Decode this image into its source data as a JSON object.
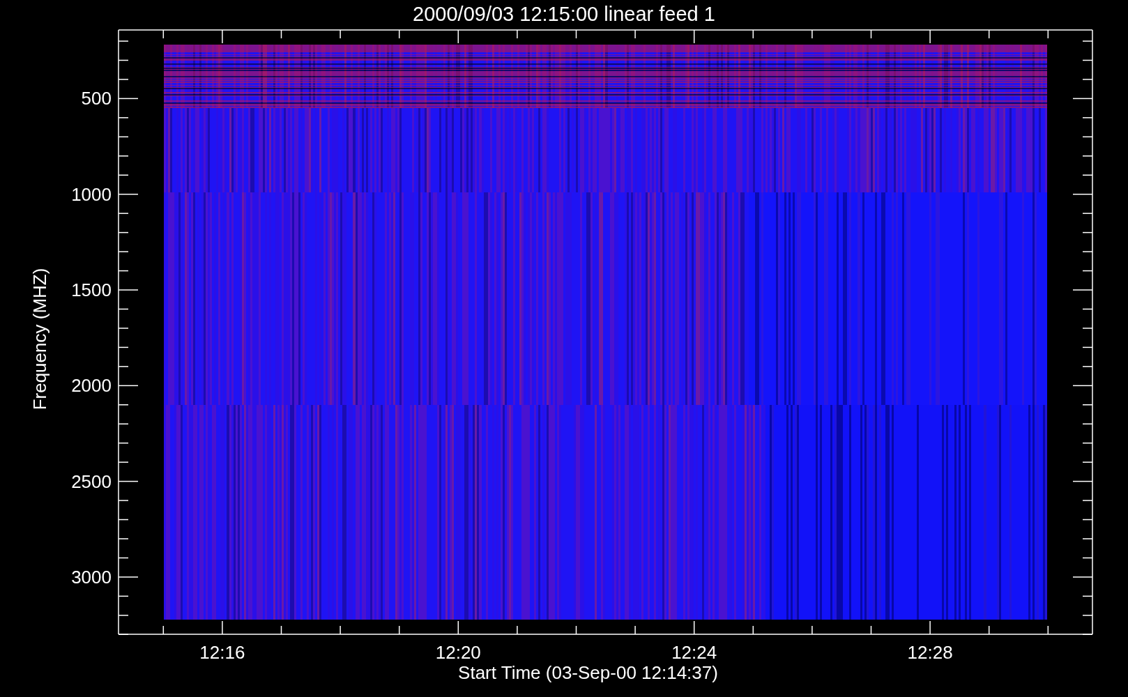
{
  "plot": {
    "title": "2000/09/03 12:15:00 linear feed 1",
    "xlabel": "Start Time (03-Sep-00 12:14:37)",
    "ylabel": "Frequency (MHZ)",
    "xtick_labels": [
      "12:16",
      "12:20",
      "12:24",
      "12:28"
    ],
    "ytick_labels": [
      "500",
      "1000",
      "1500",
      "2000",
      "2500",
      "3000"
    ]
  }
}
